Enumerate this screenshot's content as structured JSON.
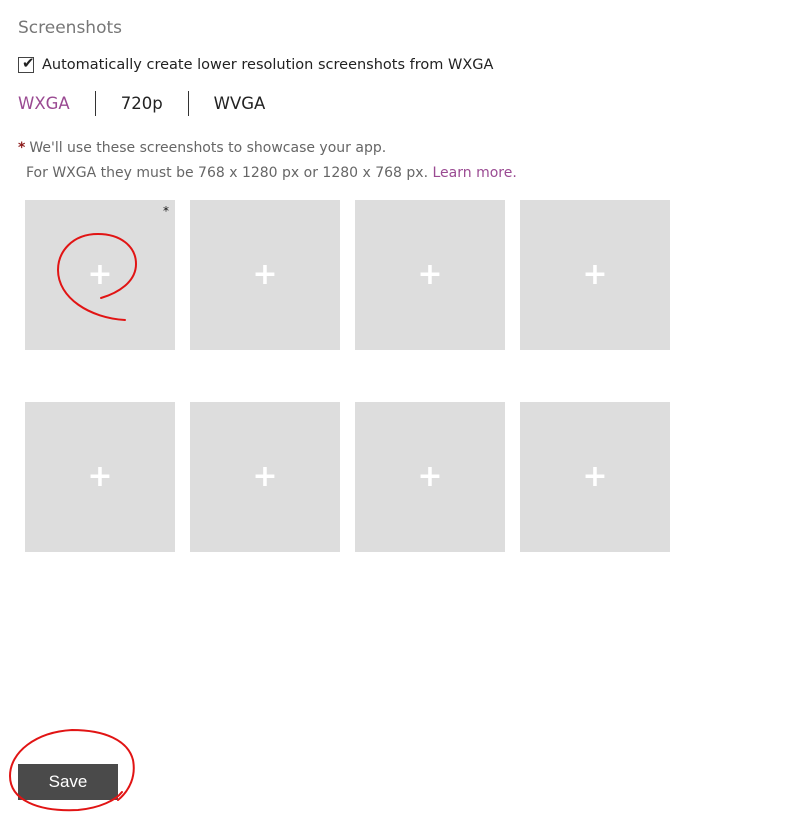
{
  "section": {
    "title": "Screenshots"
  },
  "auto": {
    "checked": true,
    "label": "Automatically create lower resolution screenshots from WXGA"
  },
  "tabs": [
    {
      "label": "WXGA",
      "active": true
    },
    {
      "label": "720p",
      "active": false
    },
    {
      "label": "WVGA",
      "active": false
    }
  ],
  "notes": {
    "required_marker": "*",
    "line1": "We'll use these screenshots to showcase your app.",
    "line2": "For WXGA they must be 768 x 1280 px or 1280 x 768 px.",
    "learn_more": "Learn more."
  },
  "slots": {
    "count": 8,
    "add_glyph": "+",
    "required_marker": "*"
  },
  "save_button": {
    "label": "Save"
  },
  "colors": {
    "accent": "#9a4a92",
    "slot_bg": "#dddddd",
    "button_bg": "#4a4a4a",
    "annotation": "#e11414"
  }
}
